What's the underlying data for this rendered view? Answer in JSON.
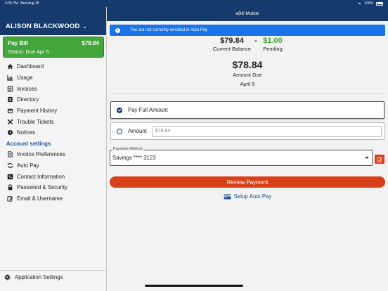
{
  "statusbar": {
    "time": "4:35 PM",
    "date": "Wed Aug 18",
    "battery": "100%"
  },
  "sidebar": {
    "app_title": "",
    "account_name": "ALISON BLACKWOOD",
    "paybill": {
      "title": "Pay Bill",
      "amount": "$78.84",
      "status": "Status: Due Apr 5"
    },
    "items": [
      {
        "label": "Dashboard",
        "icon": "home-icon"
      },
      {
        "label": "Usage",
        "icon": "bar-chart-icon"
      },
      {
        "label": "Invoices",
        "icon": "document-icon"
      },
      {
        "label": "Directory",
        "icon": "address-book-icon"
      },
      {
        "label": "Payment History",
        "icon": "calendar-icon"
      },
      {
        "label": "Trouble Tickets",
        "icon": "tools-icon"
      },
      {
        "label": "Notices",
        "icon": "alert-circle-icon"
      }
    ],
    "settings_header": "Account settings",
    "settings_items": [
      {
        "label": "Invoice Preferences",
        "icon": "file-icon"
      },
      {
        "label": "Auto Pay",
        "icon": "sync-icon"
      },
      {
        "label": "Contact Information",
        "icon": "phone-icon"
      },
      {
        "label": "Password & Security",
        "icon": "lock-icon"
      },
      {
        "label": "Email & Username",
        "icon": "edit-icon"
      }
    ],
    "bottom": {
      "label": "Application Settings",
      "icon": "gear-icon"
    }
  },
  "main": {
    "title": "eBill Mobile",
    "banner": "You are not currently enrolled in Auto Pay",
    "current_balance": {
      "amount": "$79.84",
      "label": "Current Balance"
    },
    "pending": {
      "amount": "$1.00",
      "label": "Pending"
    },
    "amount_due": {
      "amount": "$78.84",
      "label": "Amount Due",
      "date": "April 5"
    },
    "options": {
      "full": "Pay Full Amount",
      "amount": "Amount",
      "amount_placeholder": "$78.84"
    },
    "payment_method": {
      "label": "Payment Method",
      "value": "Savings **** 3123"
    },
    "review_button": "Review Payment",
    "autopay_link": "Setup Auto Pay"
  },
  "colors": {
    "header": "#163a6b",
    "green": "#43a63a",
    "accent": "#d8401a",
    "banner": "#1a73e8"
  }
}
